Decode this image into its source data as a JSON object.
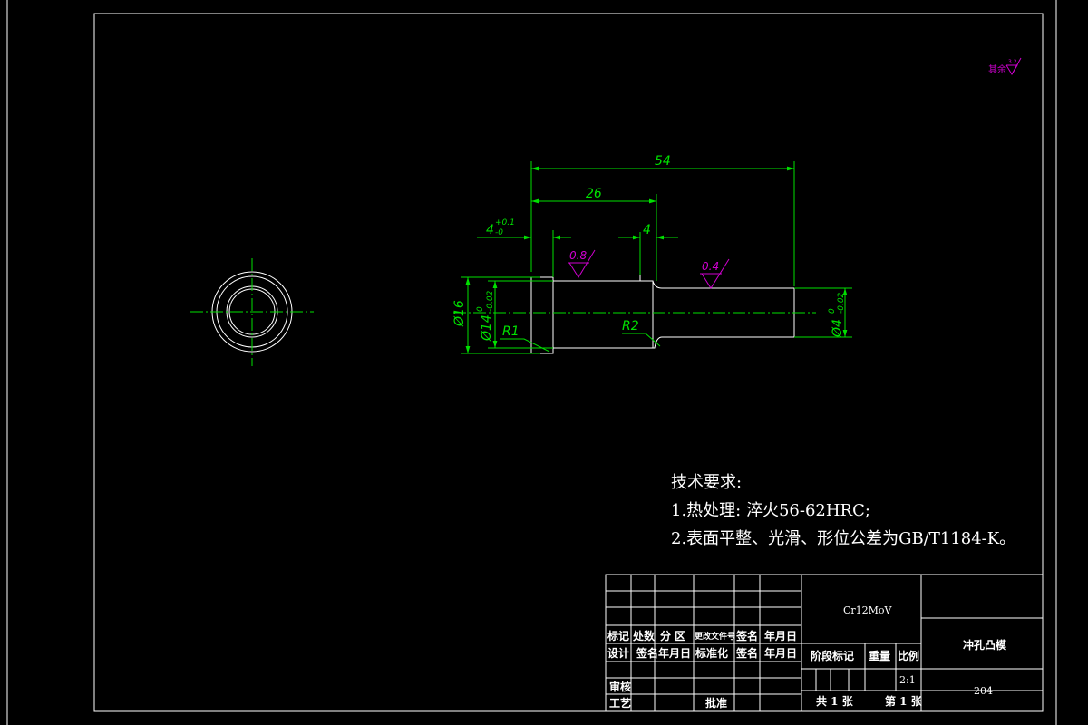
{
  "dimensions": {
    "overall_length": "54",
    "length_26": "26",
    "length_4": "4",
    "head_thickness": "4",
    "head_tol_upper": "+0.1",
    "head_tol_lower": "-0",
    "dia_16": "Ø16",
    "dia_14": "Ø14",
    "dia_14_tol_upper": "0",
    "dia_14_tol_lower": "-0.02",
    "dia_4": "Ø4",
    "dia_4_tol_upper": "0",
    "dia_4_tol_lower": "-0.02",
    "radius_1": "R1",
    "radius_2": "R2"
  },
  "roughness": {
    "mark_1": "0.8",
    "mark_2": "0.4",
    "other": "其余",
    "other_value": "3.2"
  },
  "tech_requirements": {
    "title": "技术要求:",
    "item_1": "1.热处理: 淬火56-62HRC;",
    "item_2": "2.表面平整、光滑、形位公差为GB/T1184-K。"
  },
  "title_block": {
    "material": "Cr12MoV",
    "part_name": "冲孔凸模",
    "drawing_no": "204",
    "scale": "2:1",
    "labels": {
      "mark": "标记",
      "count": "处数",
      "zone": "分 区",
      "change_doc": "更改文件号",
      "signature": "签名",
      "date": "年月日",
      "design": "设计",
      "standardize": "标准化",
      "review": "审核",
      "process": "工艺",
      "approve": "批准",
      "stage_mark": "阶段标记",
      "weight": "重量",
      "scale_label": "比例",
      "total_sheets": "共 1 张",
      "sheet_no": "第 1 张"
    }
  },
  "colors": {
    "background": "#000000",
    "outline": "#ffffff",
    "dimension": "#00e000",
    "roughness": "#d000d0"
  }
}
